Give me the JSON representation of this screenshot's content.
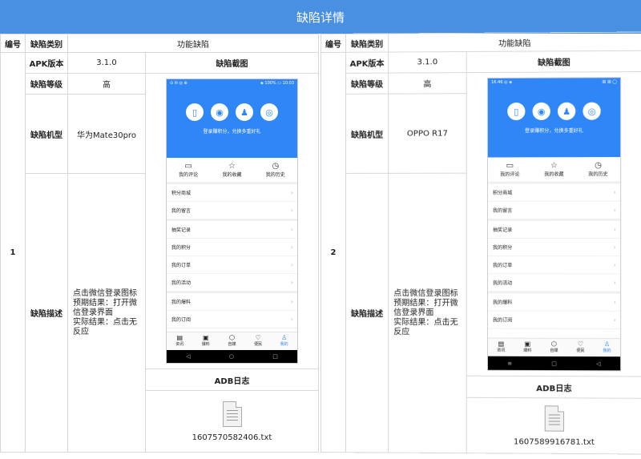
{
  "banner": {
    "title": "缺陷详情"
  },
  "labels": {
    "no": "编号",
    "type": "缺陷类别",
    "apk": "APK版本",
    "level": "缺陷等级",
    "device": "缺陷机型",
    "desc": "缺陷描述",
    "shot": "缺陷截图",
    "adb": "ADB日志"
  },
  "reports": [
    {
      "no": "1",
      "type": "功能缺陷",
      "apk": "3.1.0",
      "level": "高",
      "device": "华为Mate30pro",
      "desc": [
        "点击微信登录图标",
        "预期结果：打开微",
        "信登录界面",
        "实际结果：点击无",
        "反应"
      ],
      "file": "1607570582406.txt",
      "phone": {
        "status_left": "⊙ ✉ ◎ ⊕",
        "status_right": "◈ 100% ▭ 10:03",
        "menu": [
          "积分商城",
          "我的留言",
          "抽奖记录",
          "我的积分",
          "我的订单",
          "我的活动",
          "我的爆料",
          "我的订阅"
        ],
        "tabs": [
          "资讯",
          "爆料",
          "自媒",
          "便民",
          "我的"
        ]
      }
    },
    {
      "no": "2",
      "type": "功能缺陷",
      "apk": "3.1.0",
      "level": "高",
      "device": "OPPO R17",
      "desc": [
        "点击微信登录图标",
        "预期结果：打开微",
        "信登录界面",
        "实际结果：点击无",
        "反应"
      ],
      "file": "1607589916781.txt",
      "phone": {
        "status_left": "16:46 ◎ ◈",
        "status_right": "▥ ▥ ◯",
        "menu": [
          "积分商城",
          "我的留言",
          "抽奖记录",
          "我的积分",
          "我的订单",
          "我的活动",
          "我的爆料",
          "我的订阅"
        ],
        "tabs": [
          "资讯",
          "爆料",
          "自媒",
          "便民",
          "我的"
        ]
      }
    }
  ],
  "app": {
    "slogan": "登录赚积分，兑换多重好礼",
    "top_icons": [
      "phone-icon",
      "wechat-icon",
      "qq-icon",
      "weibo-icon"
    ],
    "shortcuts": [
      "我的评论",
      "我的收藏",
      "我的历史"
    ]
  }
}
